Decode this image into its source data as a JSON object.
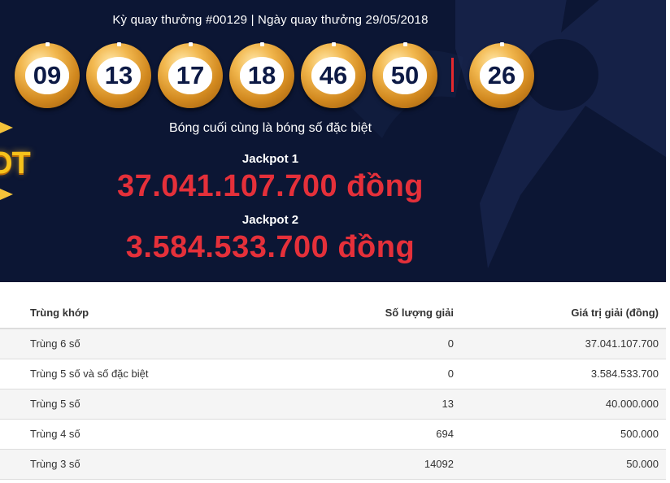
{
  "draw": {
    "info": "Kỳ quay thưởng #00129 | Ngày quay thưởng 29/05/2018",
    "numbers": [
      "09",
      "13",
      "17",
      "18",
      "46",
      "50"
    ],
    "special_number": "26",
    "special_note": "Bóng cuối cùng là bóng số đặc biệt"
  },
  "logo_fragment": "OT",
  "jackpots": [
    {
      "label": "Jackpot 1",
      "value": "37.041.107.700 đồng"
    },
    {
      "label": "Jackpot 2",
      "value": "3.584.533.700 đồng"
    }
  ],
  "table": {
    "headers": {
      "match": "Trùng khớp",
      "count": "Số lượng giải",
      "value": "Giá trị giải (đồng)"
    },
    "rows": [
      {
        "match": "Trùng 6 số",
        "count": "0",
        "value": "37.041.107.700"
      },
      {
        "match": "Trùng 5 số và số đặc biệt",
        "count": "0",
        "value": "3.584.533.700"
      },
      {
        "match": "Trùng 5 số",
        "count": "13",
        "value": "40.000.000"
      },
      {
        "match": "Trùng 4 số",
        "count": "694",
        "value": "500.000"
      },
      {
        "match": "Trùng 3 số",
        "count": "14092",
        "value": "50.000"
      }
    ]
  },
  "colors": {
    "banner_bg": "#0c1634",
    "jackpot_red": "#e5303a",
    "ball_gold": "#d2891f",
    "divider_red": "#e5292e"
  }
}
